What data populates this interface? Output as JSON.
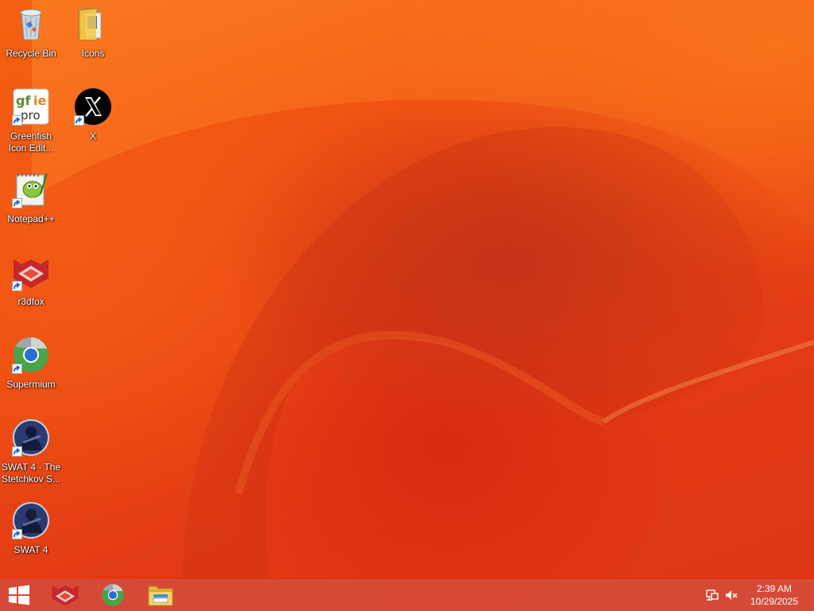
{
  "desktop": {
    "icons": [
      {
        "label": "Recycle Bin",
        "icon": "recycle-bin-icon",
        "shortcut": false
      },
      {
        "label": "Icons",
        "icon": "folder-icon",
        "shortcut": false
      },
      {
        "label": "Greenfish Icon Edit...",
        "icon": "greenfish-icon",
        "shortcut": true
      },
      {
        "label": "X",
        "icon": "x-logo-icon",
        "shortcut": true
      },
      {
        "label": "Notepad++",
        "icon": "notepad-plus-plus-icon",
        "shortcut": true
      },
      {
        "label": "r3dfox",
        "icon": "r3dfox-icon",
        "shortcut": true
      },
      {
        "label": "Supermium",
        "icon": "supermium-icon",
        "shortcut": true
      },
      {
        "label": "SWAT 4 - The Stetchkov S...",
        "icon": "swat4-icon",
        "shortcut": true
      },
      {
        "label": "SWAT 4",
        "icon": "swat4-icon",
        "shortcut": true
      }
    ]
  },
  "taskbar": {
    "start": {
      "icon": "windows-logo-icon"
    },
    "pinned": [
      {
        "name": "r3dfox",
        "icon": "r3dfox-icon"
      },
      {
        "name": "Supermium",
        "icon": "supermium-icon"
      },
      {
        "name": "File Explorer",
        "icon": "file-explorer-icon"
      }
    ],
    "tray": {
      "network_icon": "network-icon",
      "volume_icon": "volume-muted-icon",
      "time": "2:39 AM",
      "date": "10/29/2025"
    }
  },
  "colors": {
    "wallpaper_main": "#e83a10",
    "wallpaper_light": "#f76a14",
    "taskbar": "#d64a3a"
  }
}
